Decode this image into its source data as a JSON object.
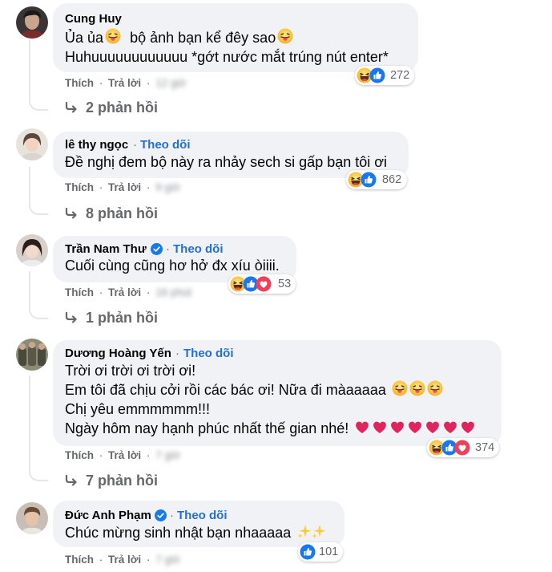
{
  "ui": {
    "like": "Thích",
    "reply": "Trả lời",
    "sep": "·",
    "follow": "Theo dõi",
    "accent": "#216fdb",
    "bubble_bg": "#f0f2f5"
  },
  "comments": [
    {
      "author": "Cung Huy",
      "lines": [
        "Ủa ủa",
        "bộ ảnh bạn kể đêy sao",
        "Huhuuuuuuuuuuuu *gớt nước mắt trúng nút enter*"
      ],
      "time": "12 giờ",
      "reactions": [
        "haha-icon",
        "like-icon"
      ],
      "reaction_count": "272",
      "replies": "2 phản hồi"
    },
    {
      "author": "lê thy ngọc",
      "lines": [
        "Đề nghị đem bộ này ra nhảy sech si gấp bạn tôi ơi"
      ],
      "time": "9 giờ",
      "reactions": [
        "haha-icon",
        "like-icon"
      ],
      "reaction_count": "862",
      "replies": "8 phản hồi"
    },
    {
      "author": "Trần Nam Thư",
      "lines": [
        "Cuối cùng cũng hơ hở đx xíu òiiii."
      ],
      "time": "16 phút",
      "reactions": [
        "haha-icon",
        "like-icon",
        "love-icon"
      ],
      "reaction_count": "53",
      "replies": "1 phản hồi"
    },
    {
      "author": "Dương Hoàng Yến",
      "lines": [
        "Trời ơi trời ơi trời ơi!",
        "Em tôi đã chịu cởi rồi các bác ơi! Nữa đi màaaaaa",
        "Chị yêu emmmmmm!!!",
        "Ngày hôm nay hạnh phúc nhất thế gian nhé!"
      ],
      "time": "7 giờ",
      "reactions": [
        "haha-icon",
        "like-icon",
        "love-icon"
      ],
      "reaction_count": "374",
      "replies": "7 phản hồi"
    },
    {
      "author": "Đức Anh Phạm",
      "lines": [
        "Chúc mừng sinh nhật bạn nhaaaaa"
      ],
      "time": "7 giờ",
      "reactions": [
        "like-icon"
      ],
      "reaction_count": "101"
    }
  ]
}
